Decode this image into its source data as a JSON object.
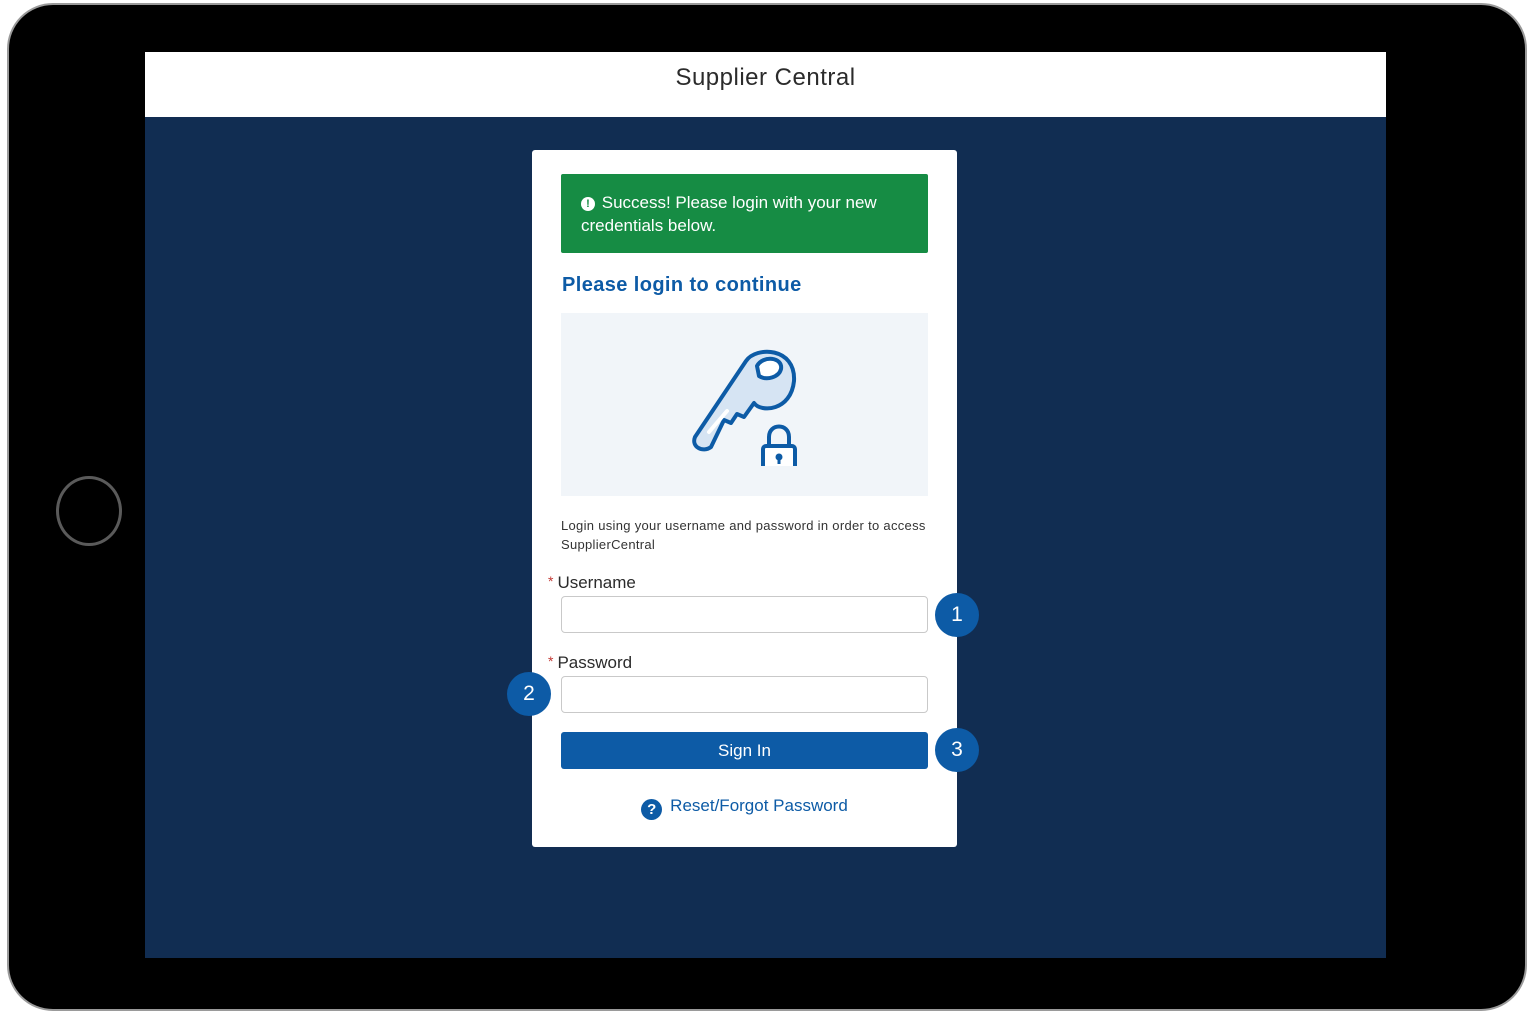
{
  "app": {
    "title": "Supplier Central"
  },
  "alert": {
    "text": "Success! Please login with your new credentials below."
  },
  "login": {
    "heading": "Please login to continue",
    "description": "Login using your username and password in order to access SupplierCentral",
    "username_label": "Username",
    "password_label": "Password",
    "required_marker": "*",
    "username_value": "",
    "password_value": "",
    "signin_label": "Sign In",
    "forgot_label": "Reset/Forgot Password"
  },
  "markers": [
    "1",
    "2",
    "3"
  ],
  "icons": {
    "alert": "exclamation-circle-icon",
    "hero": "key-lock-icon",
    "help": "question-circle-icon"
  },
  "colors": {
    "background": "#112d52",
    "primary": "#0d5ba6",
    "success": "#168c44"
  }
}
